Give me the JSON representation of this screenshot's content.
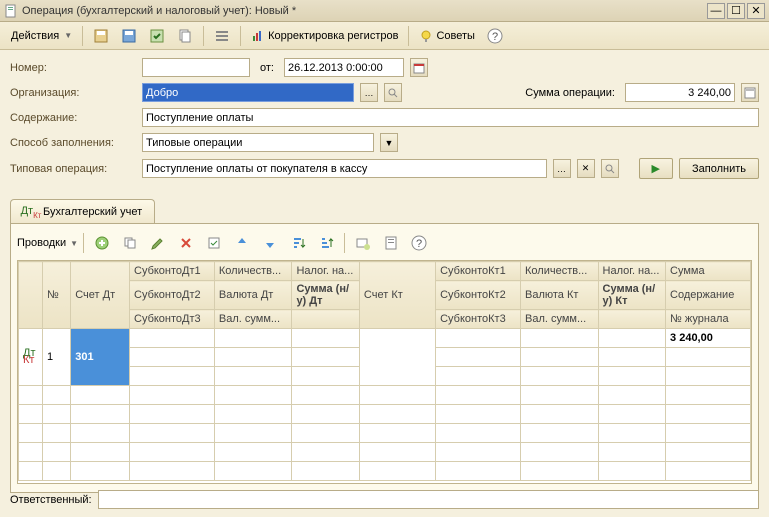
{
  "title": "Операция (бухгалтерский и налоговый учет): Новый *",
  "toolbar": {
    "actions": "Действия",
    "registers": "Корректировка регистров",
    "tips": "Советы"
  },
  "form": {
    "number_label": "Номер:",
    "number_value": "",
    "from_label": "от:",
    "date_value": "26.12.2013 0:00:00",
    "org_label": "Организация:",
    "org_value": "Добро",
    "sum_label": "Сумма операции:",
    "sum_value": "3 240,00",
    "content_label": "Содержание:",
    "content_value": "Поступление оплаты",
    "method_label": "Способ заполнения:",
    "method_value": "Типовые операции",
    "template_label": "Типовая операция:",
    "template_value": "Поступление оплаты от покупателя в кассу",
    "fill_btn": "Заполнить"
  },
  "tab": {
    "label": "Бухгалтерский учет"
  },
  "subtoolbar": {
    "label": "Проводки"
  },
  "grid": {
    "h_icon": "",
    "h_num": "№",
    "h_acc_dt": "Счет Дт",
    "h_sub_dt1": "СубконтоДт1",
    "h_sub_dt2": "СубконтоДт2",
    "h_sub_dt3": "СубконтоДт3",
    "h_qty_dt": "Количеств...",
    "h_cur_dt": "Валюта Дт",
    "h_cursum_dt": "Вал. сумм...",
    "h_tax": "Налог. на...",
    "h_sum_nu_dt": "Сумма (н/у) Дт",
    "h_acc_kt": "Счет Кт",
    "h_sub_kt1": "СубконтоКт1",
    "h_sub_kt2": "СубконтоКт2",
    "h_sub_kt3": "СубконтоКт3",
    "h_qty_kt": "Количеств...",
    "h_cur_kt": "Валюта Кт",
    "h_cursum_kt": "Вал. сумм...",
    "h_tax_kt": "Налог. на...",
    "h_sum_nu_kt": "Сумма (н/у) Кт",
    "h_sum": "Сумма",
    "h_content": "Содержание",
    "h_journal": "№ журнала",
    "row": {
      "num": "1",
      "acc_dt": "301",
      "sum": "3 240,00"
    }
  },
  "footer": {
    "responsible_label": "Ответственный:"
  },
  "chart_data": {
    "type": "table",
    "title": "Проводки",
    "columns": [
      "№",
      "Счет Дт",
      "СубконтоДт1",
      "СубконтоДт2",
      "СубконтоДт3",
      "Количество Дт",
      "Валюта Дт",
      "Вал. сумма Дт",
      "Налог. на. Дт",
      "Сумма (н/у) Дт",
      "Счет Кт",
      "СубконтоКт1",
      "СубконтоКт2",
      "СубконтоКт3",
      "Количество Кт",
      "Валюта Кт",
      "Вал. сумма Кт",
      "Налог. на. Кт",
      "Сумма (н/у) Кт",
      "Сумма",
      "Содержание",
      "№ журнала"
    ],
    "rows": [
      {
        "№": 1,
        "Счет Дт": "301",
        "Сумма": 3240.0
      }
    ]
  }
}
